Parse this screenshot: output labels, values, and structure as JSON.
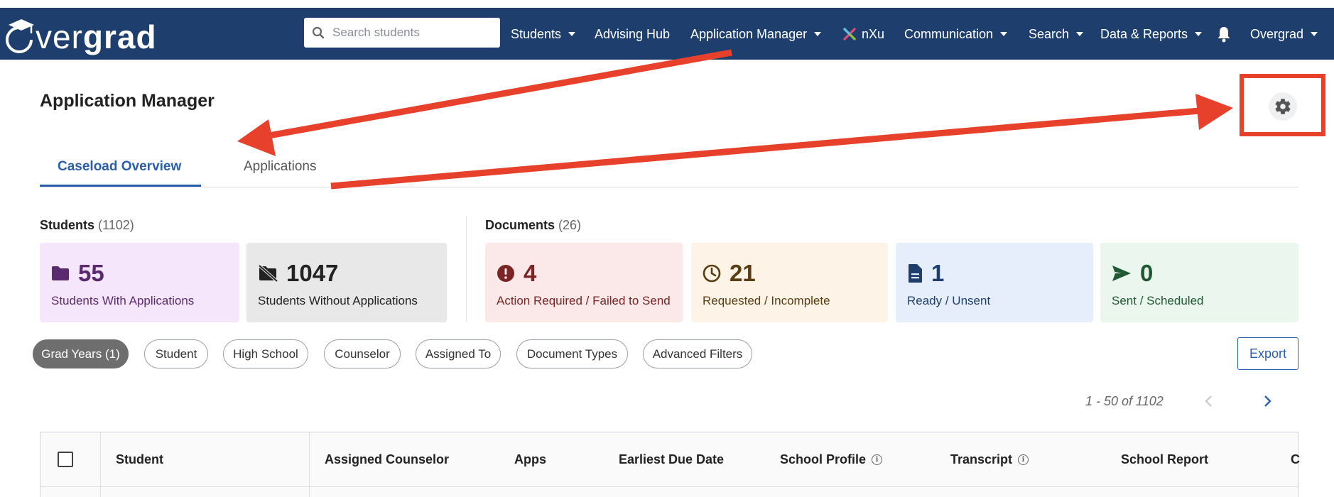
{
  "brand": {
    "logo_text_thin": "vergrad",
    "logo_text_bold": "grad",
    "name": "Overgrad"
  },
  "search": {
    "placeholder": "Search students"
  },
  "nav": {
    "students": "Students",
    "advising_hub": "Advising Hub",
    "application_manager": "Application Manager",
    "nxu": "nXu",
    "communication": "Communication",
    "search": "Search",
    "data_reports": "Data & Reports",
    "account": "Overgrad"
  },
  "page": {
    "title": "Application Manager"
  },
  "tabs": [
    {
      "label": "Caseload Overview",
      "active": true
    },
    {
      "label": "Applications",
      "active": false
    }
  ],
  "students_section": {
    "label": "Students",
    "count": "(1102)"
  },
  "documents_section": {
    "label": "Documents",
    "count": "(26)"
  },
  "cards": [
    {
      "value": "55",
      "label": "Students With Applications",
      "icon": "folder-icon",
      "bg": "#f5e6fb",
      "fg": "#5a2a6e"
    },
    {
      "value": "1047",
      "label": "Students Without Applications",
      "icon": "folder-slash-icon",
      "bg": "#e8e8e8",
      "fg": "#222222"
    },
    {
      "value": "4",
      "label": "Action Required / Failed to Send",
      "icon": "exclamation-circle-icon",
      "bg": "#fbe9e9",
      "fg": "#7a2424"
    },
    {
      "value": "21",
      "label": "Requested / Incomplete",
      "icon": "clock-icon",
      "bg": "#fdf3e6",
      "fg": "#5a3d12"
    },
    {
      "value": "1",
      "label": "Ready / Unsent",
      "icon": "file-icon",
      "bg": "#e7eefb",
      "fg": "#1e3f6e"
    },
    {
      "value": "0",
      "label": "Sent / Scheduled",
      "icon": "send-icon",
      "bg": "#eaf6ee",
      "fg": "#1f5a35"
    }
  ],
  "filters": [
    {
      "label": "Grad Years (1)",
      "active": true
    },
    {
      "label": "Student",
      "active": false
    },
    {
      "label": "High School",
      "active": false
    },
    {
      "label": "Counselor",
      "active": false
    },
    {
      "label": "Assigned To",
      "active": false
    },
    {
      "label": "Document Types",
      "active": false
    },
    {
      "label": "Advanced Filters",
      "active": false
    }
  ],
  "export_label": "Export",
  "pagination": {
    "range": "1 - 50 of 1102"
  },
  "table": {
    "columns": [
      "Student",
      "Assigned Counselor",
      "Apps",
      "Earliest Due Date",
      "School Profile",
      "Transcript",
      "School Report",
      "C"
    ]
  },
  "colors": {
    "nav_bg": "#1e3f6e",
    "accent": "#2b5eaa",
    "annotation_red": "#e8412b"
  }
}
